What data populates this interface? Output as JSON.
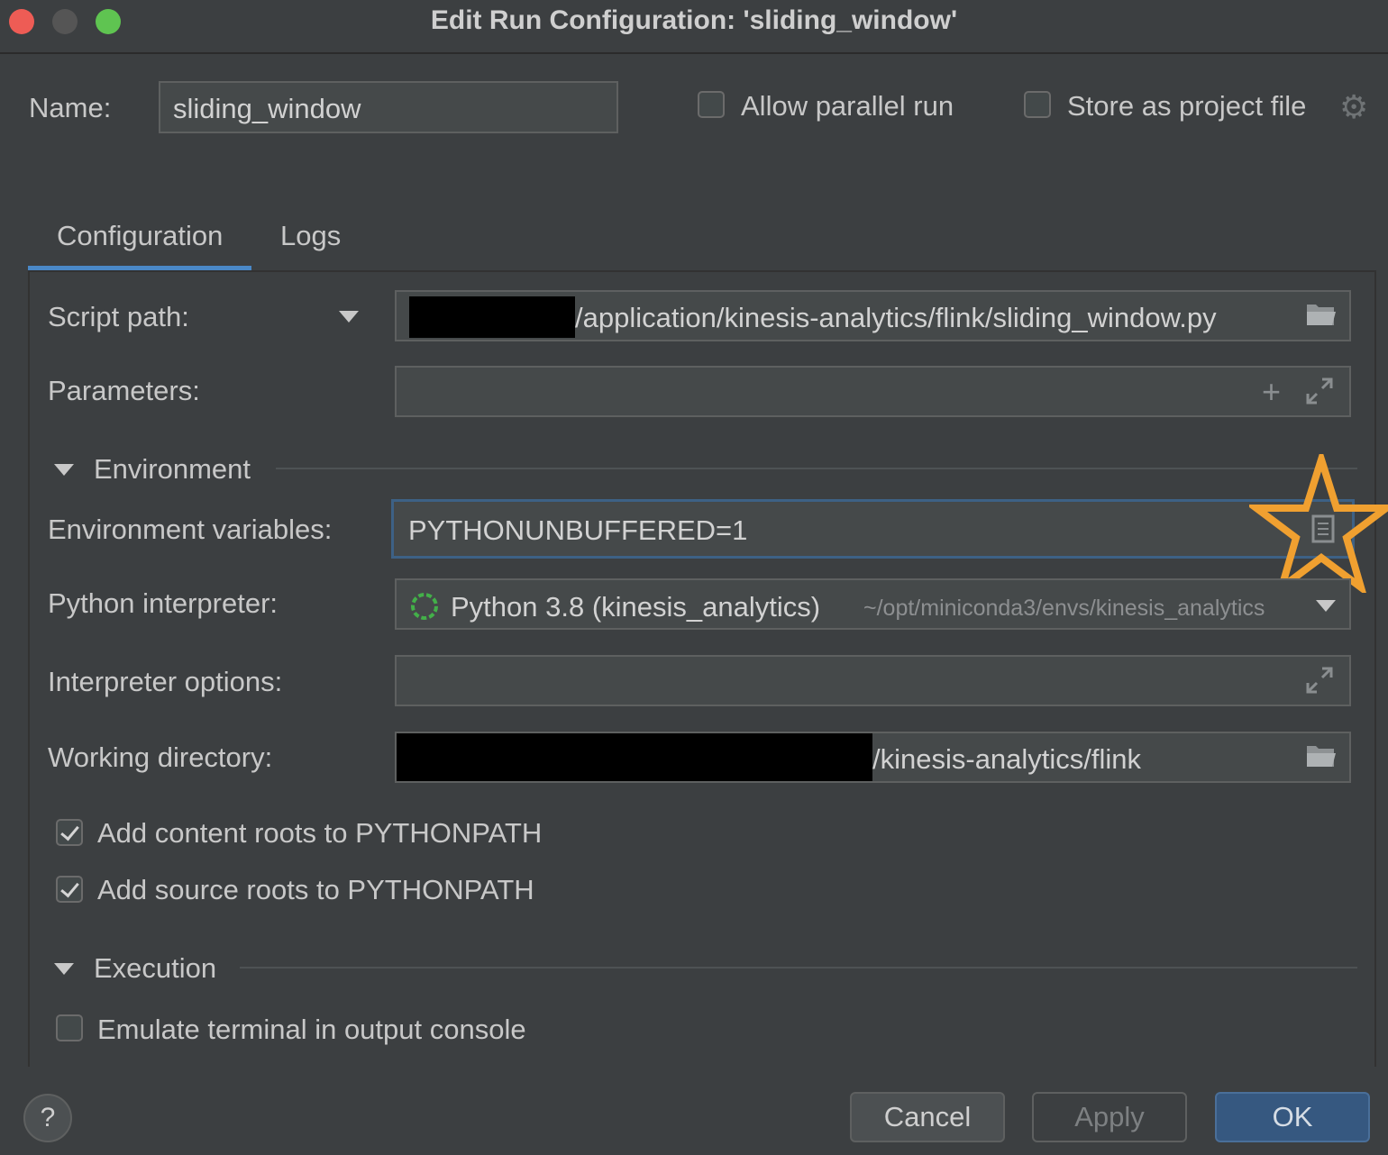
{
  "window": {
    "title": "Edit Run Configuration: 'sliding_window'"
  },
  "header": {
    "name_label": "Name:",
    "name_value": "sliding_window",
    "allow_parallel_label": "Allow parallel run",
    "store_project_label": "Store as project file"
  },
  "tabs": [
    {
      "label": "Configuration",
      "active": true
    },
    {
      "label": "Logs",
      "active": false
    }
  ],
  "form": {
    "script_path_label": "Script path:",
    "script_path_value": "/application/kinesis-analytics/flink/sliding_window.py",
    "parameters_label": "Parameters:",
    "parameters_value": "",
    "environment_section": "Environment",
    "env_vars_label": "Environment variables:",
    "env_vars_value": "PYTHONUNBUFFERED=1",
    "interpreter_label": "Python interpreter:",
    "interpreter_name": "Python 3.8 (kinesis_analytics)",
    "interpreter_path": "~/opt/miniconda3/envs/kinesis_analytics",
    "interp_options_label": "Interpreter options:",
    "interp_options_value": "",
    "working_dir_label": "Working directory:",
    "working_dir_value": "/kinesis-analytics/flink",
    "add_content_roots_label": "Add content roots to PYTHONPATH",
    "add_source_roots_label": "Add source roots to PYTHONPATH",
    "execution_section": "Execution",
    "emulate_terminal_label": "Emulate terminal in output console"
  },
  "footer": {
    "help_label": "?",
    "cancel_label": "Cancel",
    "apply_label": "Apply",
    "ok_label": "OK"
  },
  "colors": {
    "accent": "#4a88c7",
    "ok_button": "#365880",
    "star": "#f0a030",
    "close": "#ee5c55",
    "minimize": "#555555",
    "maximize": "#5fc451"
  }
}
